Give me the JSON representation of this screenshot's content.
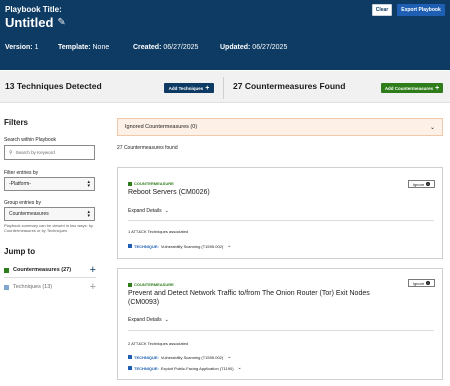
{
  "header": {
    "label": "Playbook Title:",
    "title": "Untitled",
    "edit_icon": "pencil-icon",
    "clear_label": "Clear",
    "export_label": "Export Playbook",
    "version_key": "Version:",
    "version_val": "1",
    "template_key": "Template:",
    "template_val": "None",
    "created_key": "Created:",
    "created_val": "06/27/2025",
    "updated_key": "Updated:",
    "updated_val": "06/27/2025"
  },
  "summary": {
    "techniques_title": "13 Techniques Detected",
    "add_techniques_label": "Add Techniques",
    "countermeasures_title": "27 Countermeasures Found",
    "add_countermeasures_label": "Add Countermeasures"
  },
  "sidebar": {
    "filters_title": "Filters",
    "search_label": "Search within Playbook",
    "search_placeholder": "Search by Keyword",
    "filter_label": "Filter entries by",
    "filter_value": "-Platform-",
    "group_label": "Group entries by",
    "group_value": "Countermeasures",
    "group_note": "Playbook summary can be viewed in two ways: by Countermeasures or by Techniques",
    "jump_title": "Jump to",
    "jump_items": [
      {
        "label": "Countermeasures (27)",
        "color": "#2e7d1a"
      },
      {
        "label": "Techniques (13)",
        "color": "#7fa6cf"
      }
    ]
  },
  "main": {
    "ignored_label": "Ignored Countermeasures (0)",
    "found_text": "27 Countermeasures found",
    "cards": [
      {
        "tag": "COUNTERMEASURE",
        "name": "Reboot Servers (CM0026)",
        "ignore_label": "Ignore",
        "expand_label": "Expand Details",
        "assoc": "1 ATT&CK Techniques associated",
        "techniques": [
          {
            "tag": "TECHNIQUE:",
            "name": "Vulnerability Scanning (T1595.002)"
          }
        ]
      },
      {
        "tag": "COUNTERMEASURE",
        "name": "Prevent and Detect Network Traffic to/from The Onion Router (Tor) Exit Nodes (CM0093)",
        "ignore_label": "Ignore",
        "expand_label": "Expand Details",
        "assoc": "2 ATT&CK Techniques associated",
        "techniques": [
          {
            "tag": "TECHNIQUE:",
            "name": "Vulnerability Scanning (T1595.002)"
          },
          {
            "tag": "TECHNIQUE:",
            "name": "Exploit Public-Facing Application (T1190)"
          }
        ]
      }
    ]
  },
  "colors": {
    "header_bg": "#0e3b63",
    "countermeasure_green": "#2e7d1a",
    "technique_blue": "#1e5fb4",
    "ignored_bg": "#fdf0e6"
  }
}
